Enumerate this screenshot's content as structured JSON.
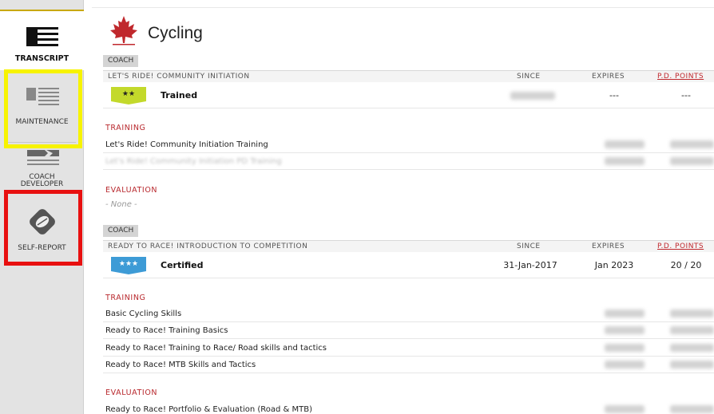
{
  "sidebar": {
    "items": [
      {
        "label": "TRANSCRIPT"
      },
      {
        "label": "MAINTENANCE"
      },
      {
        "label": "COACH\nDEVELOPER",
        "line1": "COACH",
        "line2": "DEVELOPER"
      },
      {
        "label": "SELF-REPORT"
      }
    ]
  },
  "header": {
    "title": "Cycling"
  },
  "colors": {
    "accent_red": "#c0282d",
    "badge_green": "#c3d92b",
    "badge_blue": "#3d9bd6",
    "highlight_yellow": "#f7f300",
    "highlight_red": "#e81010"
  },
  "columns": {
    "since": "SINCE",
    "expires": "EXPIRES",
    "pd_points": "P.D. POINTS"
  },
  "sections": [
    {
      "tag": "COACH",
      "name": "LET'S RIDE! COMMUNITY INITIATION",
      "stars": "★★",
      "status": "Trained",
      "since": "",
      "expires": "---",
      "pd_points": "---",
      "training_label": "TRAINING",
      "training": [
        "Let's Ride! Community Initiation Training",
        "Let's Ride! Community Initiation PD Training"
      ],
      "evaluation_label": "EVALUATION",
      "evaluation_none": "- None -"
    },
    {
      "tag": "COACH",
      "name": "READY TO RACE! INTRODUCTION TO COMPETITION",
      "stars": "★★★",
      "status": "Certified",
      "since": "31-Jan-2017",
      "expires": "Jan 2023",
      "pd_points": "20 / 20",
      "training_label": "TRAINING",
      "training": [
        "Basic Cycling Skills",
        "Ready to Race! Training Basics",
        "Ready to Race! Training to Race/ Road skills and tactics",
        "Ready to Race! MTB Skills and Tactics"
      ],
      "evaluation_label": "EVALUATION",
      "evaluation": [
        "Ready to Race! Portfolio & Evaluation (Road & MTB)"
      ]
    }
  ]
}
